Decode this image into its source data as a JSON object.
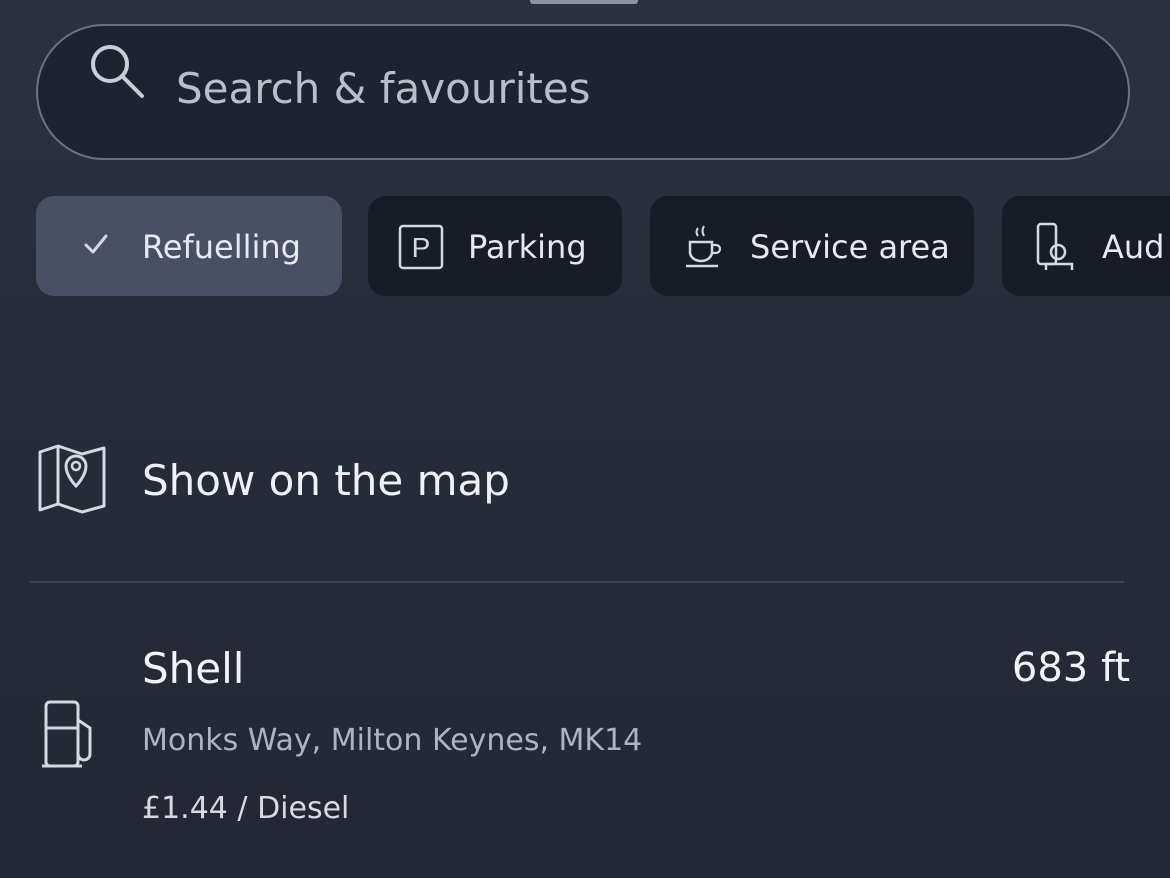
{
  "search": {
    "placeholder": "Search & favourites",
    "icon": "search-icon"
  },
  "filters": [
    {
      "label": "Refuelling",
      "icon": "check-icon",
      "selected": true
    },
    {
      "label": "Parking",
      "icon": "parking-icon",
      "selected": false
    },
    {
      "label": "Service area",
      "icon": "coffee-cup-icon",
      "selected": false
    },
    {
      "label": "Aud",
      "icon": "audi-service-icon",
      "selected": false
    }
  ],
  "map_link": {
    "label": "Show on the map",
    "icon": "map-pin-icon"
  },
  "results": [
    {
      "name": "Shell",
      "distance": "683 ft",
      "address": "Monks Way, Milton Keynes, MK14",
      "price": "£1.44 / Diesel",
      "icon": "fuel-pump-icon"
    }
  ],
  "colors": {
    "background": "#272c39",
    "chip_active": "#485164",
    "chip_inactive": "#181c27",
    "search_border": "#6c7282"
  }
}
